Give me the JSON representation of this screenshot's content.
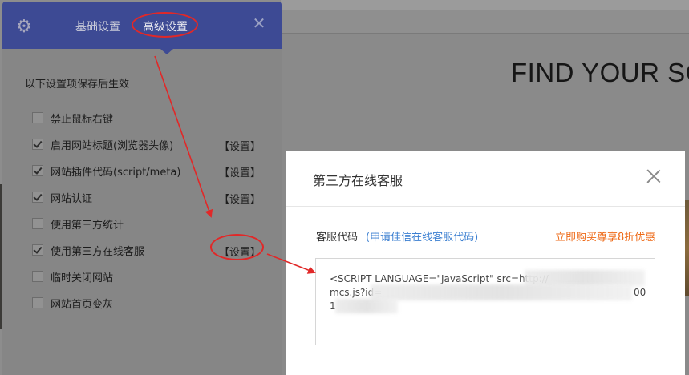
{
  "background": {
    "hero_title": "FIND YOUR SC"
  },
  "panel": {
    "gear_icon": "gear-icon",
    "tabs": [
      {
        "label": "基础设置"
      },
      {
        "label": "高级设置"
      }
    ],
    "close_glyph": "✕",
    "hint": "以下设置项保存后生效",
    "options": [
      {
        "label": "禁止鼠标右键",
        "checked": false,
        "action": ""
      },
      {
        "label": "启用网站标题(浏览器头像)",
        "checked": true,
        "action": "【设置】"
      },
      {
        "label": "网站插件代码(script/meta)",
        "checked": true,
        "action": "【设置】"
      },
      {
        "label": "网站认证",
        "checked": true,
        "action": "【设置】"
      },
      {
        "label": "使用第三方统计",
        "checked": false,
        "action": ""
      },
      {
        "label": "使用第三方在线客服",
        "checked": true,
        "action": "【设置】"
      },
      {
        "label": "临时关闭网站",
        "checked": false,
        "action": ""
      },
      {
        "label": "网站首页变灰",
        "checked": false,
        "action": ""
      }
    ]
  },
  "modal": {
    "title": "第三方在线客服",
    "code_label": "客服代码",
    "apply_link": "(申请佳信在线客服代码)",
    "promo_link": "立即购买尊享8折优惠",
    "code_lines": [
      "<SCRIPT LANGUAGE=\"JavaScript\" src=http://",
      "mcs.js?id=",
      "1"
    ],
    "code_tail": "00",
    "colors": {
      "promo": "#ee6a17",
      "link": "#3b7fd1",
      "annotation": "#e12828",
      "header": "#3d4a94"
    }
  }
}
